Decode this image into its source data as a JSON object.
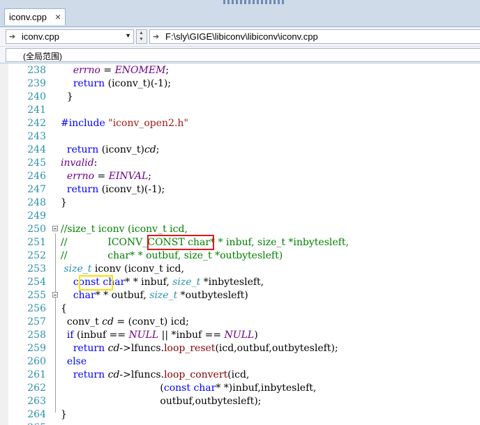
{
  "tab": {
    "label": "iconv.cpp",
    "close": "×"
  },
  "nav": {
    "file_combo": "iconv.cpp",
    "path_combo": "F:\\sly\\GIGE\\libiconv\\libiconv\\iconv.cpp",
    "file_icon": "file-arrow-icon",
    "path_icon": "file-arrow-icon"
  },
  "scope": {
    "label": "(全局范围)"
  },
  "code": {
    "lines": [
      {
        "n": "238",
        "t": "    errno = ENOMEM;"
      },
      {
        "n": "239",
        "t": "    return (iconv_t)(-1);"
      },
      {
        "n": "240",
        "t": "  }"
      },
      {
        "n": "241",
        "t": ""
      },
      {
        "n": "242",
        "t": "#include \"iconv_open2.h\""
      },
      {
        "n": "243",
        "t": ""
      },
      {
        "n": "244",
        "t": "  return (iconv_t)cd;"
      },
      {
        "n": "245",
        "t": "invalid:"
      },
      {
        "n": "246",
        "t": "  errno = EINVAL;"
      },
      {
        "n": "247",
        "t": "  return (iconv_t)(-1);"
      },
      {
        "n": "248",
        "t": "}"
      },
      {
        "n": "249",
        "t": ""
      },
      {
        "n": "250",
        "t": "//size_t iconv (iconv_t icd,"
      },
      {
        "n": "251",
        "t": "//             ICONV_CONST char* * inbuf, size_t *inbytesleft,"
      },
      {
        "n": "252",
        "t": "//             char* * outbuf, size_t *outbytesleft)"
      },
      {
        "n": "253",
        "t": " size_t iconv (iconv_t icd,"
      },
      {
        "n": "254",
        "t": "    const char* * inbuf, size_t *inbytesleft,"
      },
      {
        "n": "255",
        "t": "    char* * outbuf, size_t *outbytesleft)"
      },
      {
        "n": "256",
        "t": "{"
      },
      {
        "n": "257",
        "t": "  conv_t cd = (conv_t) icd;"
      },
      {
        "n": "258",
        "t": "  if (inbuf == NULL || *inbuf == NULL)"
      },
      {
        "n": "259",
        "t": "    return cd->lfuncs.loop_reset(icd,outbuf,outbytesleft);"
      },
      {
        "n": "260",
        "t": "  else"
      },
      {
        "n": "261",
        "t": "    return cd->lfuncs.loop_convert(icd,"
      },
      {
        "n": "262",
        "t": "                                (const char* *)inbuf,inbytesleft,"
      },
      {
        "n": "263",
        "t": "                                outbuf,outbytesleft);"
      },
      {
        "n": "264",
        "t": "}"
      },
      {
        "n": "265",
        "t": ""
      }
    ]
  },
  "highlights": {
    "red_box_text": "ICONV_CONST",
    "yellow_box_text": "const"
  },
  "colors": {
    "line_number": "#2b91af",
    "keyword": "#0000ff",
    "comment": "#008000",
    "macro": "#6f008a",
    "red_box": "#e8141a",
    "yellow_box": "#f4e400"
  }
}
